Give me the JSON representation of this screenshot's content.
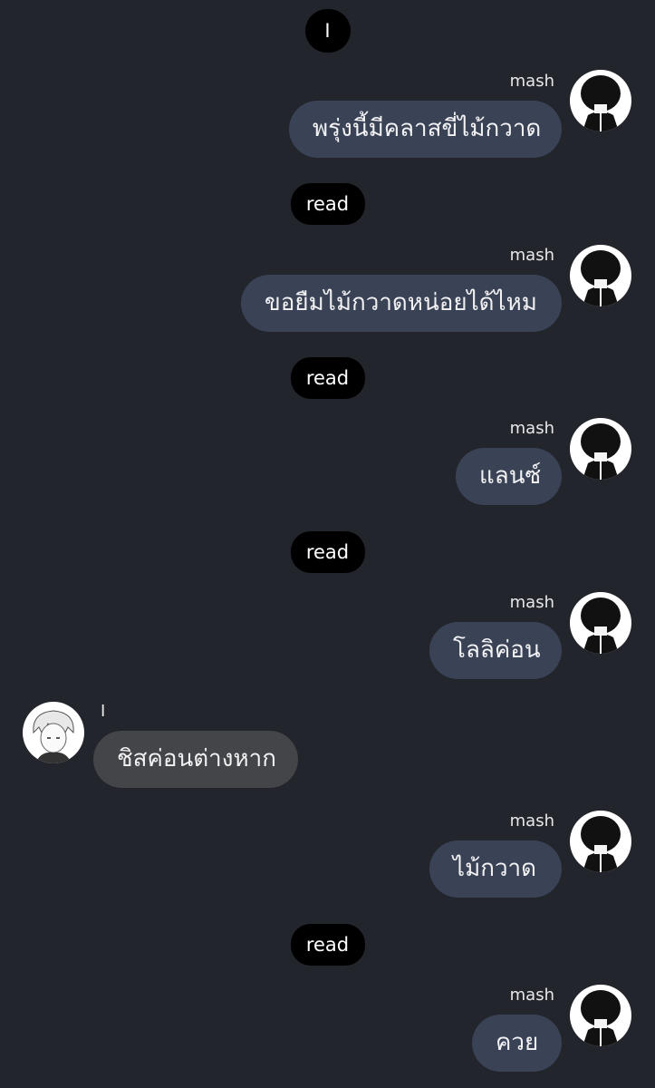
{
  "top_badge": "I",
  "read_label": "read",
  "participants": {
    "me": {
      "name": "mash",
      "avatar_icon": "mash-avatar-icon"
    },
    "other": {
      "name": "I",
      "avatar_icon": "white-haired-avatar-icon"
    }
  },
  "messages": [
    {
      "sender": "me",
      "name": "mash",
      "text": "พรุ่งนี้มีคลาสขี่ไม้กวาด"
    },
    {
      "status": "read"
    },
    {
      "sender": "me",
      "name": "mash",
      "text": "ขอยืมไม้กวาดหน่อยได้ไหม"
    },
    {
      "status": "read"
    },
    {
      "sender": "me",
      "name": "mash",
      "text": "แลนซ์"
    },
    {
      "status": "read"
    },
    {
      "sender": "me",
      "name": "mash",
      "text": "โลลิค่อน"
    },
    {
      "sender": "other",
      "name": "I",
      "text": "ชิสค่อนต่างหาก"
    },
    {
      "sender": "me",
      "name": "mash",
      "text": "ไม้กวาด"
    },
    {
      "status": "read"
    },
    {
      "sender": "me",
      "name": "mash",
      "text": "ควย"
    }
  ],
  "colors": {
    "background": "#23252c",
    "my_bubble": "#3a4355",
    "their_bubble": "#444549",
    "pill": "#000000"
  }
}
